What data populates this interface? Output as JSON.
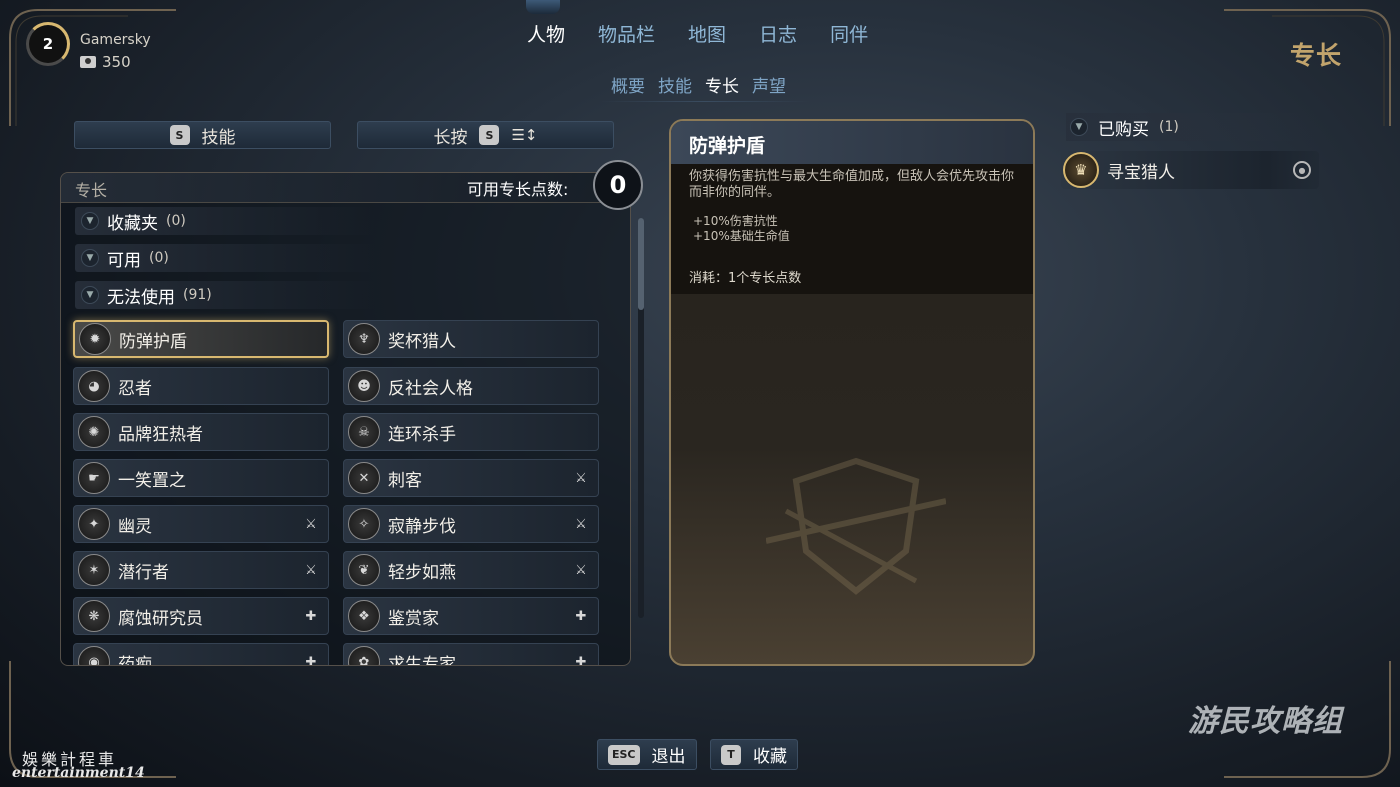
{
  "player": {
    "level": "2",
    "name": "Gamersky",
    "currency": "350",
    "currency_icon": "bills-icon"
  },
  "top_tabs": [
    {
      "label": "人物",
      "active": true
    },
    {
      "label": "物品栏",
      "active": false
    },
    {
      "label": "地图",
      "active": false
    },
    {
      "label": "日志",
      "active": false
    },
    {
      "label": "同伴",
      "active": false
    }
  ],
  "sub_tabs": [
    {
      "label": "概要",
      "active": false
    },
    {
      "label": "技能",
      "active": false
    },
    {
      "label": "专长",
      "active": true
    },
    {
      "label": "声望",
      "active": false
    }
  ],
  "page_title": "专长",
  "controls": {
    "skills_key": "S",
    "skills_label": "技能",
    "hold_label": "长按",
    "hold_key": "S",
    "sort_icon": "☰↕"
  },
  "perk_panel": {
    "header": "专长",
    "points_label": "可用专长点数:",
    "points_value": "0",
    "categories": [
      {
        "label": "收藏夹",
        "count": "(0)"
      },
      {
        "label": "可用",
        "count": "(0)"
      },
      {
        "label": "无法使用",
        "count": "(91)"
      }
    ],
    "perks": [
      {
        "label": "防弹护盾",
        "icon": "shield-icon",
        "badge": "",
        "selected": true
      },
      {
        "label": "奖杯猎人",
        "icon": "trophy-icon",
        "badge": ""
      },
      {
        "label": "忍者",
        "icon": "ninja-icon",
        "badge": ""
      },
      {
        "label": "反社会人格",
        "icon": "mask-icon",
        "badge": ""
      },
      {
        "label": "品牌狂热者",
        "icon": "splash-icon",
        "badge": ""
      },
      {
        "label": "连环杀手",
        "icon": "skull-icon",
        "badge": ""
      },
      {
        "label": "一笑置之",
        "icon": "hand-icon",
        "badge": ""
      },
      {
        "label": "刺客",
        "icon": "crossed-blades-icon",
        "badge": "stealth-icon"
      },
      {
        "label": "幽灵",
        "icon": "ghost-icon",
        "badge": "stealth-icon"
      },
      {
        "label": "寂静步伐",
        "icon": "footstep-icon",
        "badge": "stealth-icon"
      },
      {
        "label": "潜行者",
        "icon": "sneak-icon",
        "badge": "stealth-icon"
      },
      {
        "label": "轻步如燕",
        "icon": "feather-icon",
        "badge": "stealth-icon"
      },
      {
        "label": "腐蚀研究员",
        "icon": "acid-icon",
        "badge": "medkit-icon"
      },
      {
        "label": "鉴赏家",
        "icon": "gem-icon",
        "badge": "medkit-icon"
      },
      {
        "label": "药痴",
        "icon": "pill-icon",
        "badge": "medkit-icon"
      },
      {
        "label": "求生专家",
        "icon": "survival-icon",
        "badge": "medkit-icon"
      }
    ]
  },
  "detail": {
    "title": "防弹护盾",
    "description": "你获得伤害抗性与最大生命值加成，但敌人会优先攻击你而非你的同伴。",
    "stats": [
      "+10%伤害抗性",
      "+10%基础生命值"
    ],
    "cost": "消耗：1个专长点数"
  },
  "purchased": {
    "label": "已购买",
    "count": "(1)",
    "items": [
      {
        "label": "寻宝猎人",
        "icon": "treasure-icon"
      }
    ]
  },
  "bottom": {
    "exit_key": "ESC",
    "exit_label": "退出",
    "fav_key": "T",
    "fav_label": "收藏"
  },
  "watermarks": {
    "site": "游民攻略组",
    "bl_line1": "娛樂計程車",
    "bl_line2": "entertainment14"
  },
  "colors": {
    "accent_gold": "#d8b870",
    "tab_blue": "#8fb7d6",
    "title_gold": "#c2a46c"
  }
}
